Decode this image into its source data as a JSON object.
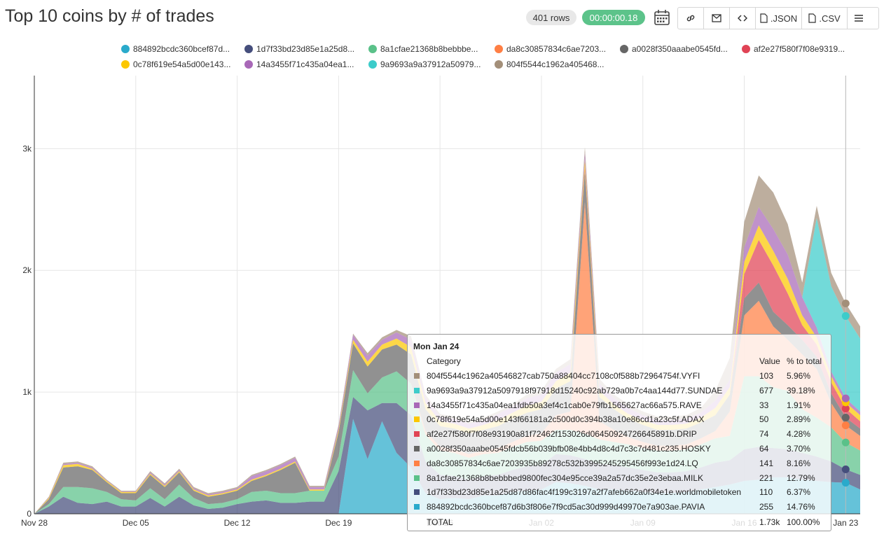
{
  "header": {
    "title": "Top 10 coins by # of trades",
    "rows_badge": "401 rows",
    "time_badge": "00:00:00.18",
    "toolbar": {
      "json_label": ".JSON",
      "csv_label": ".CSV"
    }
  },
  "colors": {
    "884892bcdc": "#2aaacb",
    "1d7f33bd23": "#454e7c",
    "8a1cfae213": "#5ac189",
    "da8c308578": "#ff7f44",
    "a0028f350a": "#666666",
    "af2e27f580": "#e04355",
    "0c78f619e5": "#fcc700",
    "14a3455f71": "#a868b7",
    "9a9693a9a3": "#3cccca",
    "804f5544c1": "#a38f79"
  },
  "chart_data": {
    "type": "area",
    "stacked": true,
    "title": "Top 10 coins by # of trades",
    "ylim": [
      0,
      3600
    ],
    "yticks": [
      "0",
      "1k",
      "2k",
      "3k"
    ],
    "xtick_labels": [
      "Nov 28",
      "Dec 05",
      "Dec 12",
      "Dec 19",
      "Dec 26",
      "Jan 02",
      "Jan 09",
      "Jan 16",
      "Jan 23"
    ],
    "grid": true,
    "legend_position": "top",
    "x": [
      "Nov 28",
      "Nov 29",
      "Nov 30",
      "Dec 01",
      "Dec 02",
      "Dec 03",
      "Dec 04",
      "Dec 05",
      "Dec 06",
      "Dec 07",
      "Dec 08",
      "Dec 09",
      "Dec 10",
      "Dec 11",
      "Dec 12",
      "Dec 13",
      "Dec 14",
      "Dec 15",
      "Dec 16",
      "Dec 17",
      "Dec 18",
      "Dec 19",
      "Dec 20",
      "Dec 21",
      "Dec 22",
      "Dec 23",
      "Dec 24",
      "Dec 25",
      "Dec 26",
      "Dec 27",
      "Dec 28",
      "Dec 29",
      "Dec 30",
      "Dec 31",
      "Jan 01",
      "Jan 02",
      "Jan 03",
      "Jan 04",
      "Jan 05",
      "Jan 06",
      "Jan 07",
      "Jan 08",
      "Jan 09",
      "Jan 10",
      "Jan 11",
      "Jan 12",
      "Jan 13",
      "Jan 14",
      "Jan 15",
      "Jan 16",
      "Jan 17",
      "Jan 18",
      "Jan 19",
      "Jan 20",
      "Jan 21",
      "Jan 22",
      "Jan 23",
      "Jan 24"
    ],
    "series": [
      {
        "name": "884892bcdc360bcef87d...",
        "key": "884892bcdc",
        "values": [
          0,
          0,
          0,
          0,
          0,
          0,
          0,
          0,
          0,
          0,
          0,
          0,
          0,
          0,
          0,
          0,
          0,
          0,
          0,
          0,
          0,
          0,
          780,
          450,
          760,
          500,
          380,
          170,
          120,
          130,
          120,
          150,
          150,
          180,
          190,
          200,
          260,
          250,
          230,
          200,
          200,
          190,
          180,
          170,
          170,
          180,
          200,
          220,
          240,
          270,
          280,
          300,
          300,
          280,
          270,
          260,
          255,
          200
        ]
      },
      {
        "name": "1d7f33bd23d85e1a25d8...",
        "key": "1d7f33bd23",
        "values": [
          0,
          60,
          140,
          90,
          80,
          100,
          60,
          60,
          130,
          60,
          140,
          70,
          40,
          50,
          80,
          100,
          110,
          90,
          90,
          100,
          100,
          350,
          180,
          400,
          150,
          410,
          430,
          260,
          200,
          180,
          160,
          160,
          170,
          180,
          200,
          200,
          230,
          230,
          220,
          210,
          200,
          190,
          180,
          170,
          170,
          170,
          180,
          200,
          200,
          260,
          270,
          240,
          230,
          220,
          200,
          170,
          110,
          120
        ]
      },
      {
        "name": "8a1cfae21368b8bebbbe...",
        "key": "8a1cfae213",
        "values": [
          0,
          20,
          80,
          130,
          130,
          80,
          60,
          50,
          80,
          60,
          100,
          60,
          40,
          40,
          40,
          80,
          80,
          80,
          80,
          90,
          90,
          120,
          220,
          140,
          210,
          260,
          260,
          220,
          200,
          190,
          180,
          180,
          180,
          190,
          200,
          200,
          200,
          210,
          210,
          200,
          190,
          190,
          180,
          180,
          180,
          180,
          190,
          200,
          200,
          600,
          580,
          500,
          480,
          360,
          320,
          280,
          221,
          200
        ]
      },
      {
        "name": "da8c30857834c6ae7203...",
        "key": "da8c308578",
        "values": [
          0,
          0,
          0,
          0,
          0,
          0,
          0,
          0,
          0,
          0,
          0,
          0,
          0,
          0,
          0,
          0,
          0,
          0,
          0,
          0,
          0,
          0,
          0,
          0,
          0,
          0,
          0,
          30,
          30,
          30,
          30,
          30,
          40,
          40,
          50,
          60,
          120,
          150,
          1900,
          150,
          100,
          60,
          50,
          40,
          40,
          40,
          50,
          60,
          200,
          500,
          620,
          500,
          420,
          450,
          400,
          200,
          141,
          120
        ]
      },
      {
        "name": "a0028f350aaabe0545fd...",
        "key": "a0028f350a",
        "values": [
          0,
          40,
          160,
          170,
          150,
          80,
          50,
          60,
          110,
          100,
          100,
          60,
          60,
          70,
          70,
          90,
          120,
          190,
          250,
          0,
          0,
          200,
          220,
          220,
          230,
          220,
          240,
          180,
          170,
          170,
          170,
          170,
          180,
          190,
          190,
          200,
          220,
          250,
          260,
          200,
          170,
          150,
          140,
          130,
          130,
          130,
          130,
          130,
          140,
          140,
          150,
          120,
          120,
          120,
          100,
          80,
          64,
          60
        ]
      },
      {
        "name": "af2e27f580f7f08e9319...",
        "key": "af2e27f580",
        "values": [
          0,
          0,
          0,
          0,
          0,
          0,
          0,
          0,
          0,
          0,
          0,
          0,
          0,
          0,
          0,
          0,
          0,
          0,
          0,
          0,
          0,
          0,
          0,
          0,
          0,
          0,
          0,
          0,
          0,
          0,
          0,
          0,
          0,
          0,
          0,
          0,
          0,
          0,
          30,
          0,
          0,
          0,
          0,
          0,
          0,
          0,
          0,
          0,
          0,
          200,
          350,
          380,
          260,
          120,
          100,
          90,
          74,
          60
        ]
      },
      {
        "name": "0c78f619e54a5d00e143...",
        "key": "0c78f619e5",
        "values": [
          0,
          10,
          20,
          20,
          10,
          10,
          10,
          10,
          10,
          10,
          10,
          10,
          10,
          10,
          10,
          10,
          10,
          10,
          10,
          10,
          10,
          20,
          30,
          40,
          40,
          50,
          60,
          50,
          40,
          40,
          40,
          40,
          50,
          50,
          60,
          60,
          60,
          70,
          60,
          50,
          40,
          40,
          40,
          40,
          40,
          40,
          40,
          60,
          60,
          100,
          120,
          120,
          120,
          80,
          60,
          50,
          50,
          50
        ]
      },
      {
        "name": "14a3455f71c435a04ea1...",
        "key": "14a3455f71",
        "values": [
          0,
          5,
          10,
          10,
          10,
          5,
          5,
          5,
          10,
          10,
          10,
          10,
          10,
          10,
          10,
          30,
          30,
          30,
          30,
          20,
          20,
          30,
          40,
          50,
          40,
          50,
          60,
          50,
          40,
          40,
          40,
          40,
          50,
          50,
          60,
          60,
          70,
          70,
          60,
          60,
          50,
          50,
          40,
          40,
          40,
          40,
          40,
          60,
          60,
          120,
          150,
          180,
          200,
          150,
          80,
          40,
          33,
          30
        ]
      },
      {
        "name": "9a9693a9a37912a50979...",
        "key": "9a9693a9a3",
        "values": [
          0,
          0,
          0,
          0,
          0,
          0,
          0,
          0,
          0,
          0,
          0,
          0,
          0,
          0,
          0,
          0,
          0,
          0,
          0,
          0,
          0,
          0,
          0,
          0,
          0,
          0,
          0,
          0,
          0,
          0,
          0,
          0,
          0,
          0,
          0,
          0,
          0,
          0,
          0,
          0,
          0,
          0,
          0,
          0,
          0,
          0,
          0,
          0,
          0,
          0,
          0,
          0,
          0,
          0,
          900,
          700,
          677,
          600
        ]
      },
      {
        "name": "804f5544c1962a405468...",
        "key": "804f5544c1",
        "values": [
          0,
          5,
          10,
          10,
          10,
          5,
          5,
          5,
          10,
          10,
          10,
          10,
          10,
          10,
          10,
          10,
          10,
          10,
          10,
          10,
          10,
          10,
          10,
          20,
          20,
          20,
          30,
          20,
          20,
          20,
          20,
          20,
          20,
          20,
          30,
          30,
          30,
          40,
          40,
          40,
          30,
          30,
          30,
          30,
          30,
          30,
          40,
          80,
          180,
          210,
          260,
          300,
          250,
          120,
          100,
          110,
          103,
          100
        ]
      }
    ]
  },
  "tooltip": {
    "date": "Mon Jan 24",
    "col_category": "Category",
    "col_value": "Value",
    "col_pct": "% to total",
    "rows": [
      {
        "key": "804f5544c1",
        "category": "804f5544c1962a40546827cab750a88404cc7108c0f588b72964754f.VYFI",
        "value": "103",
        "pct": "5.96%"
      },
      {
        "key": "9a9693a9a3",
        "category": "9a9693a9a37912a5097918f97918d15240c92ab729a0b7c4aa144d77.SUNDAE",
        "value": "677",
        "pct": "39.18%"
      },
      {
        "key": "14a3455f71",
        "category": "14a3455f71c435a04ea1fdb50a3ef4c1cab0e79fb1565627ac66a575.RAVE",
        "value": "33",
        "pct": "1.91%"
      },
      {
        "key": "0c78f619e5",
        "category": "0c78f619e54a5d00e143f66181a2c500d0c394b38a10e86cd1a23c5f.ADAX",
        "value": "50",
        "pct": "2.89%"
      },
      {
        "key": "af2e27f580",
        "category": "af2e27f580f7f08e93190a81f72462f153026d06450924726645891b.DRIP",
        "value": "74",
        "pct": "4.28%"
      },
      {
        "key": "a0028f350a",
        "category": "a0028f350aaabe0545fdcb56b039bfb08e4bb4d8c4d7c3c7d481c235.HOSKY",
        "value": "64",
        "pct": "3.70%"
      },
      {
        "key": "da8c308578",
        "category": "da8c30857834c6ae7203935b89278c532b3995245295456f993e1d24.LQ",
        "value": "141",
        "pct": "8.16%"
      },
      {
        "key": "8a1cfae213",
        "category": "8a1cfae21368b8bebbbed9800fec304e95cce39a2a57dc35e2e3ebaa.MILK",
        "value": "221",
        "pct": "12.79%"
      },
      {
        "key": "1d7f33bd23",
        "category": "1d7f33bd23d85e1a25d87d86fac4f199c3197a2f7afeb662a0f34e1e.worldmobiletoken",
        "value": "110",
        "pct": "6.37%"
      },
      {
        "key": "884892bcdc",
        "category": "884892bcdc360bcef87d6b3f806e7f9cd5ac30d999d49970e7a903ae.PAVIA",
        "value": "255",
        "pct": "14.76%"
      }
    ],
    "total_label": "TOTAL",
    "total_value": "1.73k",
    "total_pct": "100.00%"
  }
}
